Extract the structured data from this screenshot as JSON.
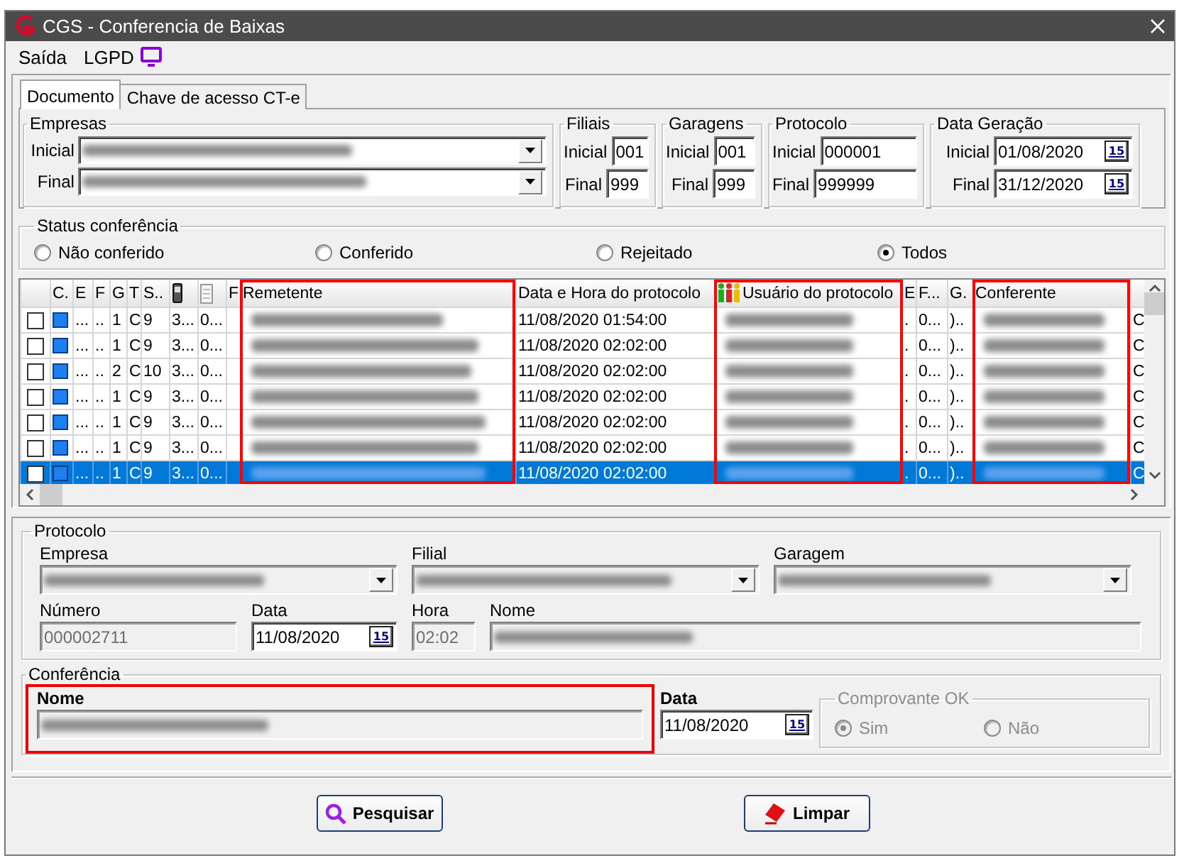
{
  "window": {
    "title": "CGS - Conferencia de Baixas"
  },
  "menu": [
    {
      "label": "Saída"
    },
    {
      "label": "LGPD"
    }
  ],
  "tabs": [
    {
      "label": "Documento",
      "selected": true
    },
    {
      "label": "Chave de acesso CT-e",
      "selected": false
    }
  ],
  "filter_groups": [
    {
      "kind": "combo",
      "title": "Empresas",
      "fields": [
        {
          "label": "Inicial"
        },
        {
          "label": "Final"
        }
      ]
    },
    {
      "kind": "text",
      "title": "Filiais",
      "fields": [
        {
          "label": "Inicial",
          "value": "001"
        },
        {
          "label": "Final",
          "value": "999"
        }
      ]
    },
    {
      "kind": "text",
      "title": "Garagens",
      "fields": [
        {
          "label": "Inicial",
          "value": "001"
        },
        {
          "label": "Final",
          "value": "999"
        }
      ]
    },
    {
      "kind": "text",
      "title": "Protocolo",
      "fields": [
        {
          "label": "Inicial",
          "value": "000001"
        },
        {
          "label": "Final",
          "value": "999999"
        }
      ]
    },
    {
      "kind": "date",
      "title": "Data Geração",
      "fields": [
        {
          "label": "Inicial",
          "value": "01/08/2020",
          "calendar": "15"
        },
        {
          "label": "Final",
          "value": "31/12/2020",
          "calendar": "15"
        }
      ]
    }
  ],
  "status": {
    "title": "Status conferência",
    "options": [
      {
        "label": "Não conferido",
        "selected": false
      },
      {
        "label": "Conferido",
        "selected": false
      },
      {
        "label": "Rejeitado",
        "selected": false
      },
      {
        "label": "Todos",
        "selected": true
      }
    ]
  },
  "grid": {
    "columns": [
      {
        "kind": "check",
        "highlighted": false
      },
      {
        "kind": "swatch",
        "label": "C.",
        "highlighted": false
      },
      {
        "kind": "text",
        "label": "E",
        "highlighted": false
      },
      {
        "kind": "text",
        "label": "F",
        "highlighted": false
      },
      {
        "kind": "text",
        "label": "G",
        "highlighted": false
      },
      {
        "kind": "text",
        "label": "T",
        "highlighted": false
      },
      {
        "kind": "text",
        "label": "S..",
        "highlighted": false
      },
      {
        "kind": "phone",
        "highlighted": false
      },
      {
        "kind": "page",
        "highlighted": false
      },
      {
        "kind": "text",
        "label": "F",
        "highlighted": false
      },
      {
        "kind": "blurred",
        "label": "Remetente",
        "highlighted": true
      },
      {
        "kind": "text",
        "label": "Data e Hora do protocolo",
        "highlighted": false
      },
      {
        "kind": "people",
        "label": "Usuário do protocolo",
        "highlighted": true
      },
      {
        "kind": "text",
        "label": "E",
        "highlighted": false
      },
      {
        "kind": "text",
        "label": "F...",
        "highlighted": false
      },
      {
        "kind": "text",
        "label": "G.",
        "highlighted": false
      },
      {
        "kind": "blurred",
        "label": "Conferente",
        "highlighted": true
      },
      {
        "kind": "text",
        "highlighted": false
      }
    ],
    "rows": [
      {
        "checked": false,
        "selected": false,
        "cells": [
          "",
          "",
          "...",
          "..",
          "1",
          "C",
          "9",
          "3...",
          "0...",
          "",
          "",
          "11/08/2020 01:54:00",
          "",
          ".",
          "0...",
          ")..",
          "",
          "C"
        ]
      },
      {
        "checked": false,
        "selected": false,
        "cells": [
          "",
          "",
          "...",
          "..",
          "1",
          "C",
          "9",
          "3...",
          "0...",
          "",
          "",
          "11/08/2020 02:02:00",
          "",
          ".",
          "0...",
          ")..",
          "",
          "C"
        ]
      },
      {
        "checked": false,
        "selected": false,
        "cells": [
          "",
          "",
          "...",
          "..",
          "2",
          "C",
          "10",
          "3...",
          "0...",
          "",
          "",
          "11/08/2020 02:02:00",
          "",
          ".",
          "0...",
          ")..",
          "",
          "C"
        ]
      },
      {
        "checked": false,
        "selected": false,
        "cells": [
          "",
          "",
          "...",
          "..",
          "1",
          "C",
          "9",
          "3...",
          "0...",
          "",
          "",
          "11/08/2020 02:02:00",
          "",
          ".",
          "0...",
          ")..",
          "",
          "C"
        ]
      },
      {
        "checked": false,
        "selected": false,
        "cells": [
          "",
          "",
          "...",
          "..",
          "1",
          "C",
          "9",
          "3...",
          "0...",
          "",
          "",
          "11/08/2020 02:02:00",
          "",
          ".",
          "0...",
          ")..",
          "",
          "C"
        ]
      },
      {
        "checked": false,
        "selected": false,
        "cells": [
          "",
          "",
          "...",
          "..",
          "1",
          "C",
          "9",
          "3...",
          "0...",
          "",
          "",
          "11/08/2020 02:02:00",
          "",
          ".",
          "0...",
          ")..",
          "",
          "C"
        ]
      },
      {
        "checked": false,
        "selected": true,
        "cells": [
          "",
          "",
          "...",
          "..",
          "1",
          "C",
          "9",
          "3...",
          "0...",
          "",
          "",
          "11/08/2020 02:02:00",
          "",
          ".",
          "0...",
          ")..",
          "",
          "C"
        ]
      }
    ]
  },
  "protocol": {
    "title": "Protocolo",
    "fields": [
      {
        "kind": "combo",
        "label": "Empresa",
        "disabled": true
      },
      {
        "kind": "combo",
        "label": "Filial",
        "disabled": true
      },
      {
        "kind": "combo",
        "label": "Garagem",
        "disabled": true
      },
      {
        "kind": "text",
        "label": "Número",
        "value": "000002711",
        "disabled": true
      },
      {
        "kind": "date",
        "label": "Data",
        "value": "11/08/2020",
        "calendar": "15",
        "disabled": false
      },
      {
        "kind": "text",
        "label": "Hora",
        "value": "02:02",
        "disabled": true
      },
      {
        "kind": "blurred",
        "label": "Nome",
        "disabled": true
      }
    ]
  },
  "conferencia": {
    "title": "Conferência",
    "name": {
      "label": "Nome",
      "highlighted": true
    },
    "date": {
      "label": "Data",
      "value": "11/08/2020",
      "calendar": "15"
    },
    "comprovante": {
      "title": "Comprovante OK",
      "disabled": true,
      "options": [
        {
          "label": "Sim",
          "selected": true
        },
        {
          "label": "Não",
          "selected": false
        }
      ]
    }
  },
  "buttons": [
    {
      "kind": "search",
      "label": "Pesquisar"
    },
    {
      "kind": "erase",
      "label": "Limpar"
    }
  ]
}
